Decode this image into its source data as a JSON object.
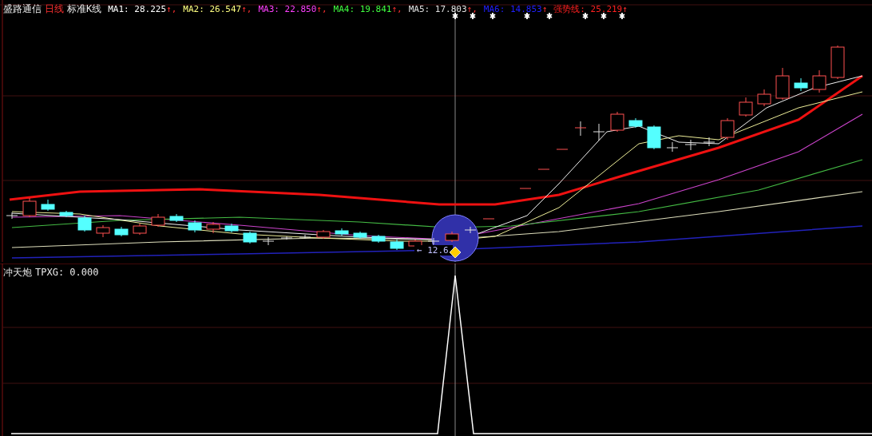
{
  "main_panel": {
    "legend": {
      "stock_name": "盛路通信",
      "period": "日线",
      "chart_type": "标准K线",
      "indicators": [
        {
          "name": "MA1:",
          "value": "28.225",
          "arrow": "↑,",
          "color": "#ffffff"
        },
        {
          "name": "MA2:",
          "value": "26.547",
          "arrow": "↑,",
          "color": "#ffff80"
        },
        {
          "name": "MA3:",
          "value": "22.850",
          "arrow": "↑,",
          "color": "#ff40ff"
        },
        {
          "name": "MA4:",
          "value": "19.841",
          "arrow": "↑,",
          "color": "#40ff40"
        },
        {
          "name": "MA5:",
          "value": "17.803",
          "arrow": "↑,",
          "color": "#e0e0e0"
        },
        {
          "name": "MA6:",
          "value": "14.853",
          "arrow": "↑",
          "color": "#2020ff"
        },
        {
          "name": "强势线:",
          "value": "25.219",
          "arrow": "↑",
          "color": "#ff2020"
        }
      ]
    },
    "price_label": "← 12.6"
  },
  "sub_panel": {
    "indicator_name": "冲天炮",
    "variable": "TPXG:",
    "value": "0.000"
  }
}
